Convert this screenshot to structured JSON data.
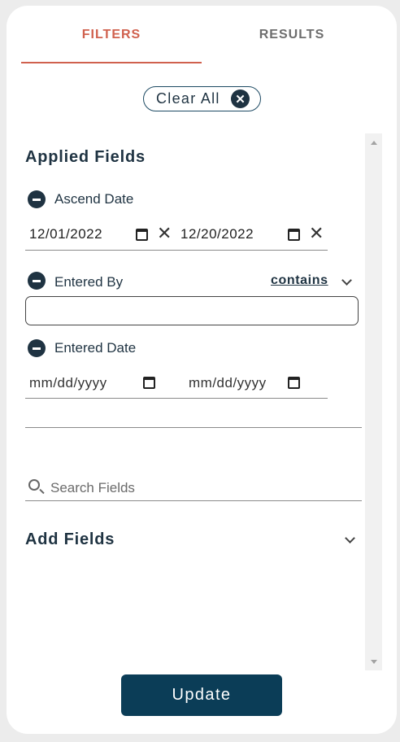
{
  "tabs": {
    "filters": "FILTERS",
    "results": "RESULTS"
  },
  "clear_all": {
    "label": "Clear All",
    "icon": "close-circle-icon"
  },
  "applied": {
    "title": "Applied Fields",
    "ascend_date": {
      "label": "Ascend Date",
      "from": "12/01/2022",
      "to": "12/20/2022"
    },
    "entered_by": {
      "label": "Entered By",
      "operator": "contains",
      "value": ""
    },
    "entered_date": {
      "label": "Entered Date",
      "from_placeholder": "mm/dd/yyyy",
      "to_placeholder": "mm/dd/yyyy"
    }
  },
  "search": {
    "placeholder": "Search Fields"
  },
  "add_fields": {
    "title": "Add Fields"
  },
  "update_button": "Update",
  "colors": {
    "accent": "#d0614e",
    "primary": "#0b3d57",
    "text": "#1f3342"
  }
}
